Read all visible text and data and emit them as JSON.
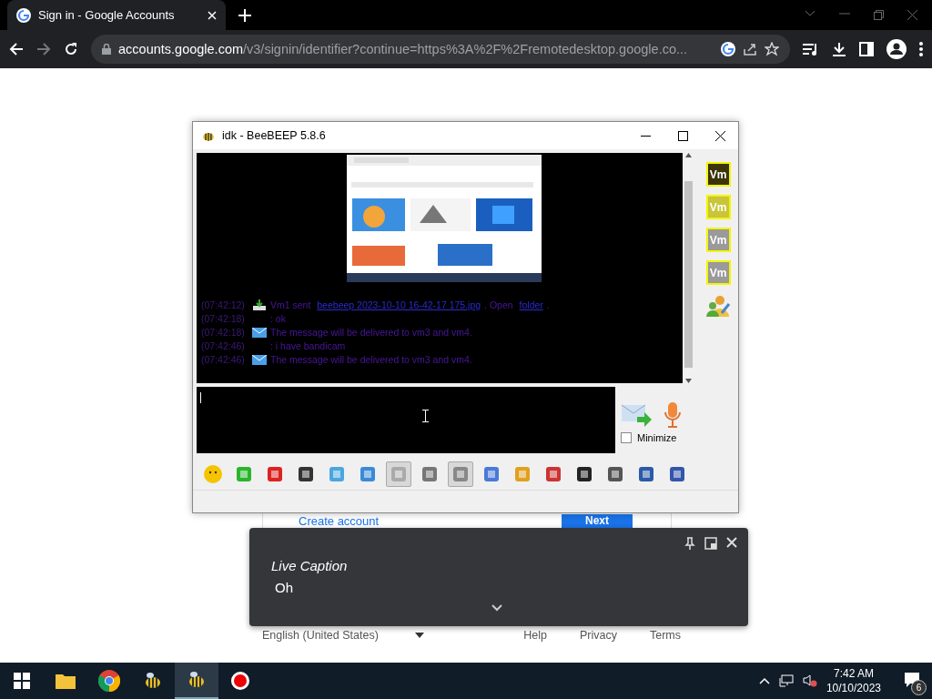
{
  "browser": {
    "tab": {
      "title": "Sign in - Google Accounts",
      "selected": true
    },
    "url_host": "accounts.google.com",
    "url_path": "/v3/signin/identifier?continue=https%3A%2F%2Fremotedesktop.google.co..."
  },
  "signin_page": {
    "create_account": "Create account",
    "next_button": "Next",
    "language": "English (United States)",
    "footer_links": [
      "Help",
      "Privacy",
      "Terms"
    ]
  },
  "app_window": {
    "title": "idk - BeeBEEP 5.8.6",
    "chat": [
      {
        "time": "(07:42:12)",
        "kind": "file",
        "parts": [
          {
            "text": "Vm1 sent ",
            "link": false
          },
          {
            "text": "beebeep 2023-10-10 16-42-17 175.jpg",
            "link": true
          },
          {
            "text": ". Open ",
            "link": false
          },
          {
            "text": "folder",
            "link": true
          },
          {
            "text": ".",
            "link": false
          }
        ]
      },
      {
        "time": "(07:42:18)",
        "kind": "text",
        "parts": [
          {
            "text": ": ok",
            "link": false
          }
        ]
      },
      {
        "time": "(07:42:18)",
        "kind": "mail",
        "parts": [
          {
            "text": "The message will be delivered to vm3 and vm4.",
            "link": false
          }
        ]
      },
      {
        "time": "(07:42:46)",
        "kind": "text",
        "parts": [
          {
            "text": ": i have bandicam",
            "link": false
          }
        ]
      },
      {
        "time": "(07:42:46)",
        "kind": "mail",
        "parts": [
          {
            "text": "The message will be delivered to vm3 and vm4.",
            "link": false
          }
        ]
      }
    ],
    "users": [
      {
        "label": "Vm",
        "color": "#3a3408"
      },
      {
        "label": "Vm",
        "color": "#c9c53a"
      },
      {
        "label": "Vm",
        "color": "#9a9a9a"
      },
      {
        "label": "Vm",
        "color": "#9a9a9a"
      }
    ],
    "minimize": {
      "label": "Minimize",
      "checked": false
    },
    "toolbar": [
      {
        "pressed": false
      },
      {
        "pressed": false
      },
      {
        "pressed": false
      },
      {
        "pressed": false
      },
      {
        "pressed": false
      },
      {
        "pressed": false
      },
      {
        "pressed": true
      },
      {
        "pressed": false
      },
      {
        "pressed": true
      },
      {
        "pressed": false
      },
      {
        "pressed": false
      },
      {
        "pressed": false
      },
      {
        "pressed": false
      },
      {
        "pressed": false
      },
      {
        "pressed": false
      },
      {
        "pressed": false
      }
    ]
  },
  "live_caption": {
    "title": "Live Caption",
    "text": "Oh"
  },
  "taskbar": {
    "apps": [
      {
        "kind": "explorer",
        "active": false
      },
      {
        "kind": "chrome",
        "active": false
      },
      {
        "kind": "bee",
        "active": false
      },
      {
        "kind": "bee",
        "active": true
      },
      {
        "kind": "record",
        "active": false
      }
    ],
    "time": "7:42 AM",
    "date": "10/10/2023",
    "notifications": "6"
  }
}
